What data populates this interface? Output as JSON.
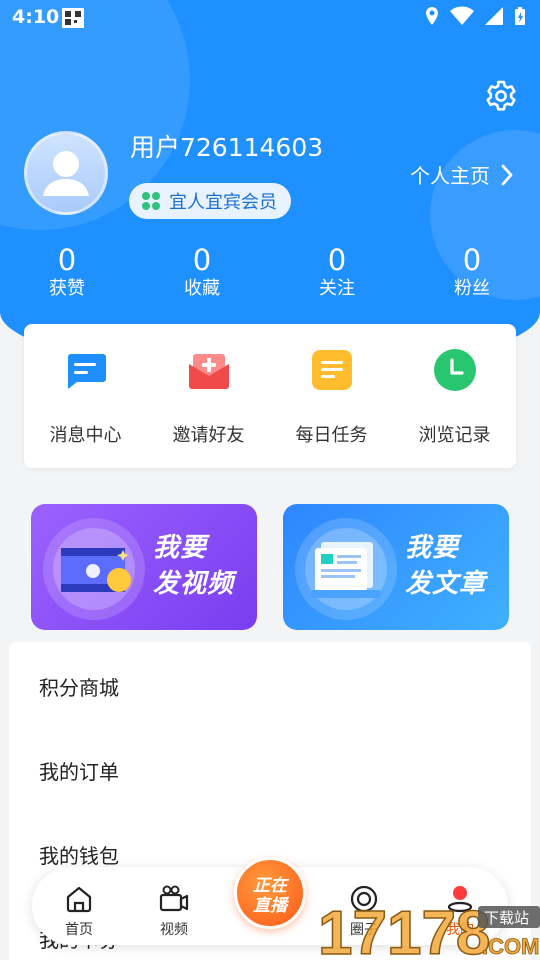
{
  "status_bar": {
    "time": "4:10"
  },
  "profile": {
    "username": "用户726114603",
    "member_badge": "宜人宜宾会员",
    "homepage_link": "个人主页"
  },
  "stats": [
    {
      "value": "0",
      "label": "获赞"
    },
    {
      "value": "0",
      "label": "收藏"
    },
    {
      "value": "0",
      "label": "关注"
    },
    {
      "value": "0",
      "label": "粉丝"
    }
  ],
  "quick_actions": [
    {
      "label": "消息中心",
      "icon": "message-icon",
      "color": "#1e8fff"
    },
    {
      "label": "邀请好友",
      "icon": "invite-envelope-icon",
      "color": "#f04a4a"
    },
    {
      "label": "每日任务",
      "icon": "task-list-icon",
      "color": "#ffbd2e"
    },
    {
      "label": "浏览记录",
      "icon": "history-clock-icon",
      "color": "#28c76f"
    }
  ],
  "promos": [
    {
      "line1": "我要",
      "line2": "发视频",
      "icon": "video-film-icon"
    },
    {
      "line1": "我要",
      "line2": "发文章",
      "icon": "article-paper-icon"
    }
  ],
  "menu": [
    {
      "label": "积分商城"
    },
    {
      "label": "我的订单"
    },
    {
      "label": "我的钱包"
    },
    {
      "label": "我的卡券"
    }
  ],
  "tabbar": {
    "tabs": [
      {
        "label": "首页",
        "icon": "home-icon"
      },
      {
        "label": "视频",
        "icon": "video-camera-icon"
      },
      {
        "label": "圈子",
        "icon": "circle-target-icon"
      },
      {
        "label": "我的",
        "icon": "profile-icon"
      }
    ],
    "live_line1": "正在",
    "live_line2": "直播",
    "active_tab": "我的"
  },
  "watermark": {
    "text": "17178",
    "sub": "下载站",
    "suffix": ".COM"
  },
  "colors": {
    "primary": "#1e90ff",
    "active_tab": "#e8590c"
  }
}
